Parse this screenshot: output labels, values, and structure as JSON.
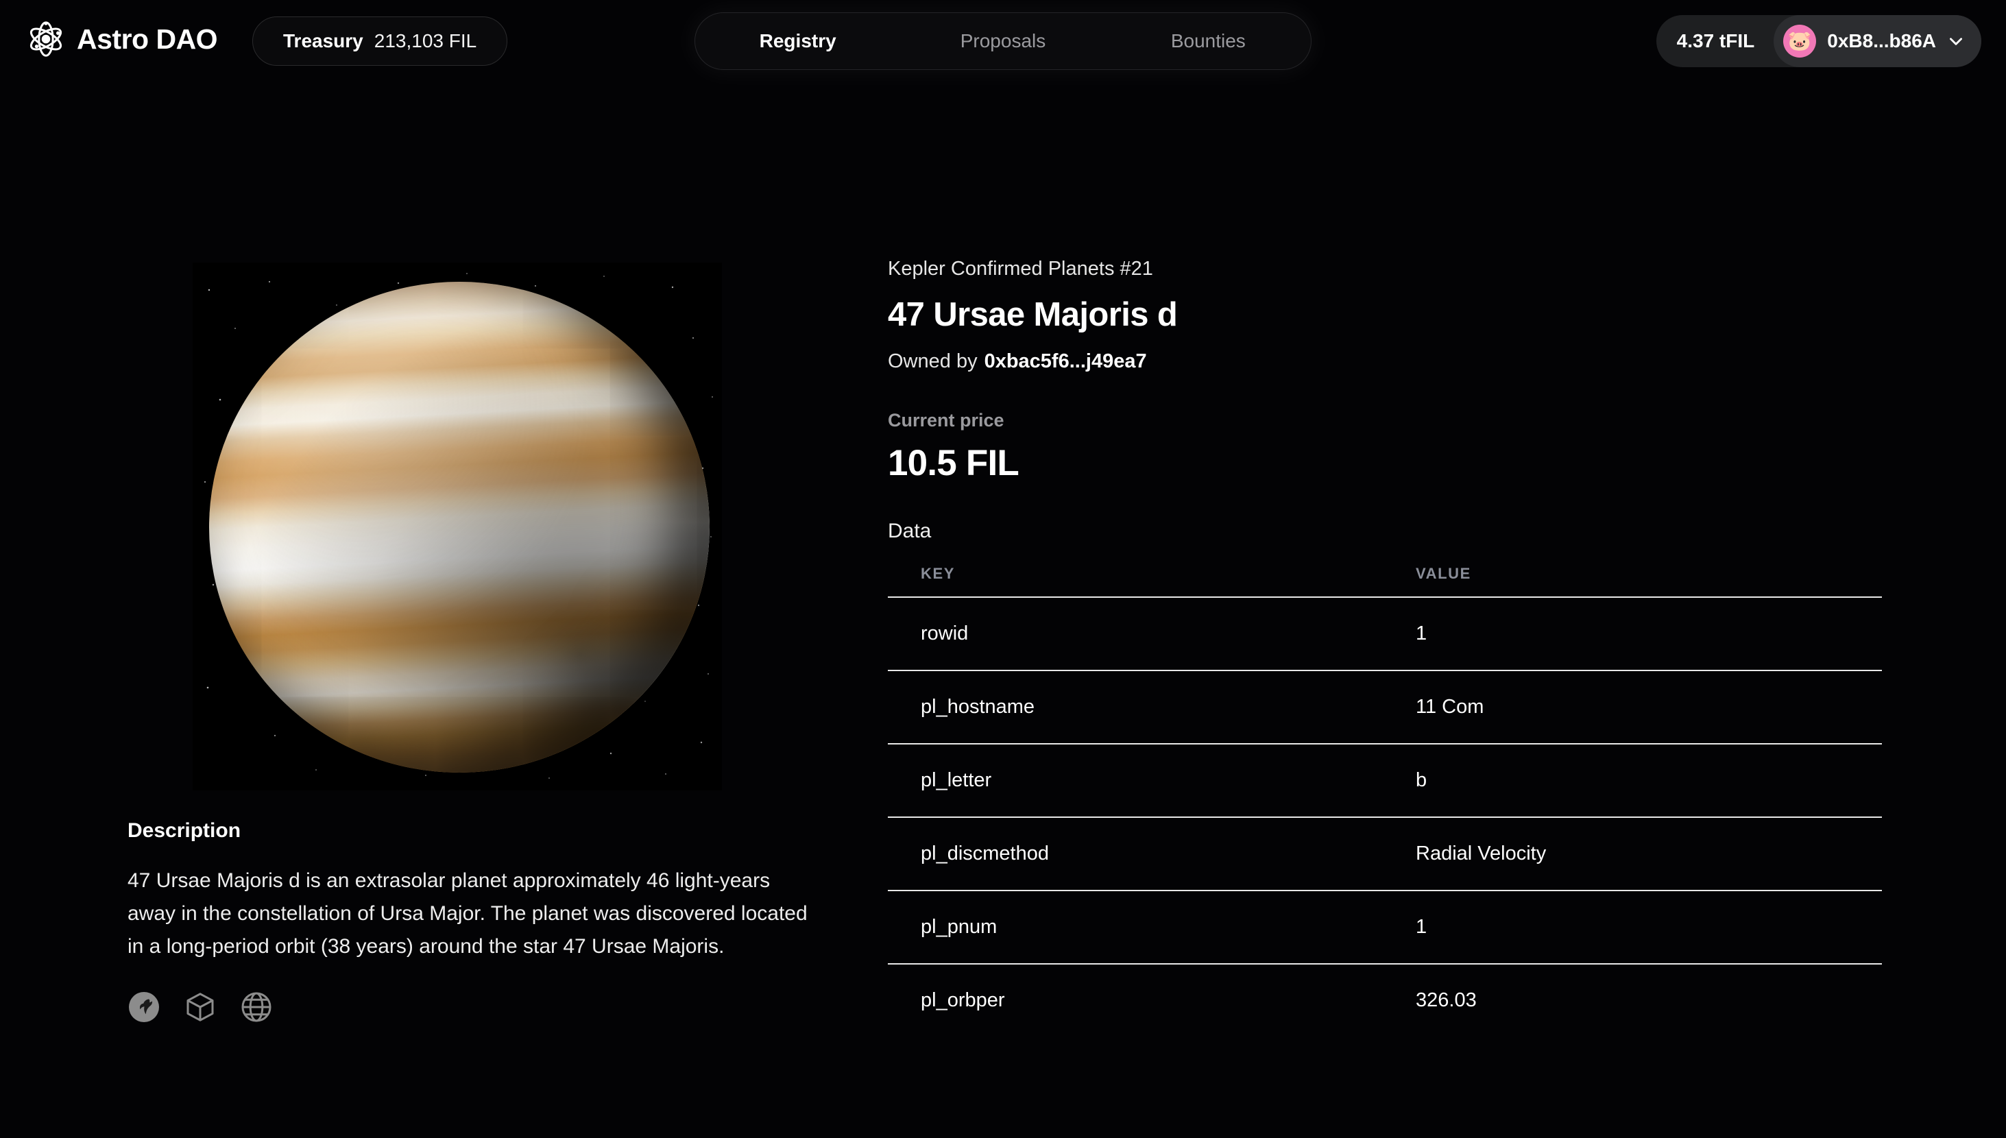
{
  "header": {
    "brand": {
      "icon": "atom-icon",
      "name": "Astro DAO"
    },
    "treasury": {
      "label": "Treasury",
      "value": "213,103 FIL"
    },
    "nav": [
      {
        "label": "Registry",
        "active": true
      },
      {
        "label": "Proposals",
        "active": false
      },
      {
        "label": "Bounties",
        "active": false
      }
    ],
    "wallet": {
      "balance": "4.37 tFIL",
      "address": "0xB8...b86A",
      "avatar_emoji": "🐷",
      "avatar_color": "#f178b6",
      "chevron": "chevron-down-icon"
    }
  },
  "asset": {
    "collection": "Kepler Confirmed Planets #21",
    "title": "47 Ursae Majoris d",
    "owner_prefix": "Owned by",
    "owner_address": "0xbac5f6...j49ea7",
    "price_label": "Current price",
    "price_value": "10.5 FIL",
    "image_alt": "gas-giant-planet-with-orange-bands"
  },
  "description": {
    "heading": "Description",
    "body": "47 Ursae Majoris d is an extrasolar planet approximately 46 light-years away in the constellation of Ursa Major. The planet was discovered located in a long-period orbit (38 years) around the star 47 Ursae Majoris."
  },
  "social_links": [
    {
      "icon": "marketplace-logo-icon"
    },
    {
      "icon": "cube-icon"
    },
    {
      "icon": "globe-icon"
    }
  ],
  "data_section": {
    "label": "Data",
    "columns": [
      "KEY",
      "VALUE"
    ],
    "rows": [
      {
        "key": "rowid",
        "value": "1"
      },
      {
        "key": "pl_hostname",
        "value": "11 Com"
      },
      {
        "key": "pl_letter",
        "value": "b"
      },
      {
        "key": "pl_discmethod",
        "value": "Radial Velocity"
      },
      {
        "key": "pl_pnum",
        "value": "1"
      },
      {
        "key": "pl_orbper",
        "value": "326.03"
      }
    ]
  },
  "colors": {
    "background": "#030305",
    "accent_pink": "#f178b6",
    "divider": "#e9e9e9",
    "muted_text": "#9a9a9e"
  }
}
